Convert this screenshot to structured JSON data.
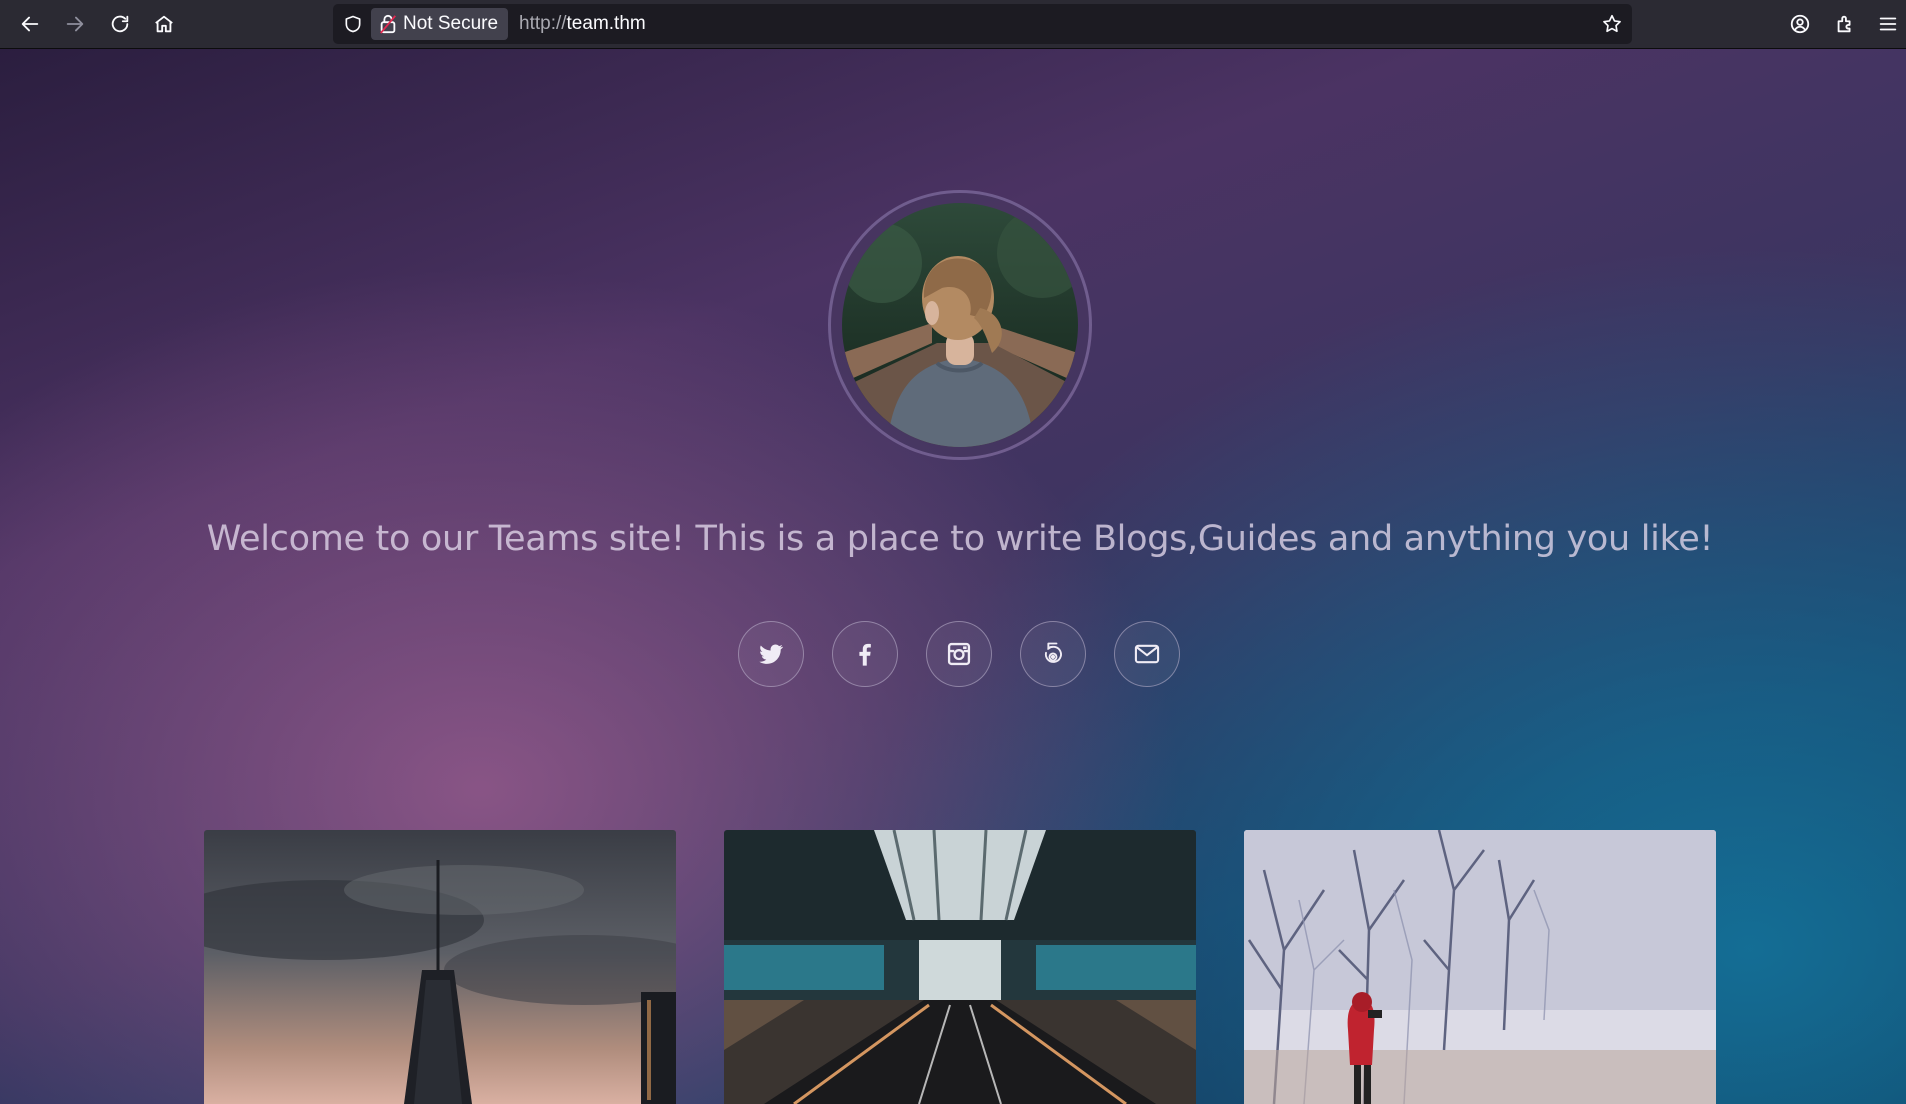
{
  "browser": {
    "url_protocol": "http://",
    "url_host": "team.thm",
    "security_label": "Not Secure",
    "icons": {
      "back": "arrow-left-icon",
      "forward": "arrow-right-icon",
      "reload": "reload-icon",
      "home": "home-icon",
      "shield": "tracking-shield-icon",
      "lock": "insecure-lock-icon",
      "bookmark": "star-icon",
      "account": "account-icon",
      "extensions": "puzzle-icon",
      "menu": "hamburger-icon"
    }
  },
  "hero": {
    "welcome_text": "Welcome to our Teams site! This is a place to write Blogs,Guides and anything you like!",
    "social_icons": [
      "twitter-icon",
      "facebook-icon",
      "instagram-icon",
      "500px-icon",
      "envelope-icon"
    ]
  },
  "colors": {
    "toolbar_bg": "#2b2a33",
    "urlbar_bg": "#1c1b22",
    "page_purple": "#4b3363",
    "page_teal": "#1c6a8a",
    "text_light": "#e1d7eb"
  }
}
